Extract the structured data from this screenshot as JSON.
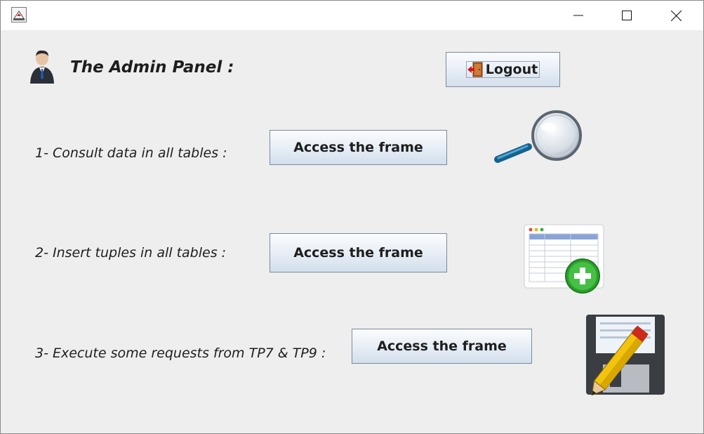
{
  "window": {
    "controls": {
      "minimize_icon": "minimize-icon",
      "maximize_icon": "maximize-icon",
      "close_icon": "close-icon"
    }
  },
  "header": {
    "title": "The Admin Panel  :",
    "logout_label": "Logout"
  },
  "rows": [
    {
      "label": "1- Consult data in all tables :",
      "button": "Access the frame",
      "icon": "magnifier-icon"
    },
    {
      "label": "2- Insert tuples in all tables :",
      "button": "Access the frame",
      "icon": "table-add-icon"
    },
    {
      "label": "3- Execute some requests from TP7 & TP9 :",
      "button": "Access the frame",
      "icon": "save-edit-icon"
    }
  ],
  "colors": {
    "button_border": "#7a8aa0",
    "button_top": "#fbfcfe",
    "button_bottom": "#d3dfec",
    "background": "#eeeeee"
  }
}
